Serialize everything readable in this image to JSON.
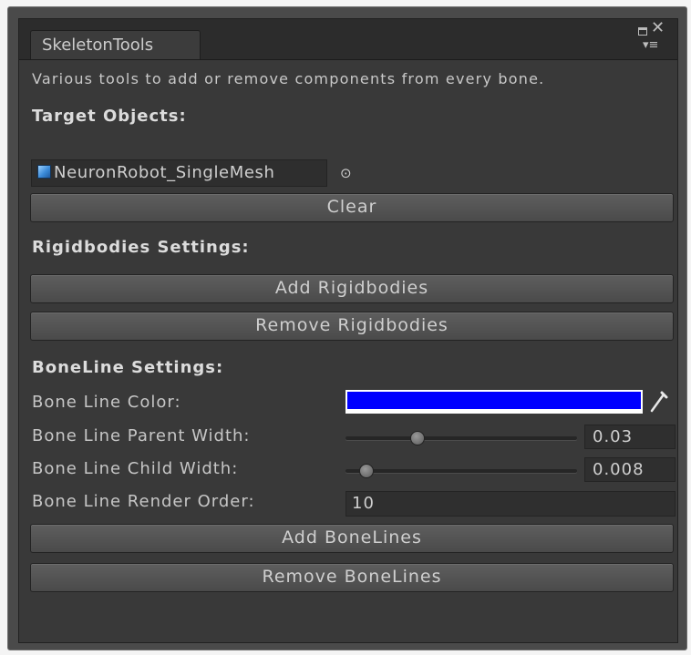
{
  "window": {
    "tab_title": "SkeletonTools",
    "controls": [
      "maximize-icon",
      "close-icon",
      "menu-icon"
    ]
  },
  "description": "Various tools to add or remove components from every bone.",
  "target": {
    "header": "Target Objects:",
    "object_name": "NeuronRobot_SingleMesh",
    "object_icon": "mesh-icon",
    "picker_icon": "object-picker-icon",
    "clear_label": "Clear"
  },
  "rigidbodies": {
    "header": "Rigidbodies Settings:",
    "add_label": "Add Rigidbodies",
    "remove_label": "Remove Rigidbodies"
  },
  "boneline": {
    "header": "BoneLine Settings:",
    "color_label": "Bone Line Color:",
    "color_value": "#0000ff",
    "parent_width_label": "Bone Line Parent Width:",
    "parent_width_value": "0.03",
    "parent_width_fraction": 0.31,
    "child_width_label": "Bone Line Child Width:",
    "child_width_value": "0.008",
    "child_width_fraction": 0.09,
    "render_order_label": "Bone Line Render Order:",
    "render_order_value": "10",
    "add_label": "Add BoneLines",
    "remove_label": "Remove BoneLines"
  }
}
